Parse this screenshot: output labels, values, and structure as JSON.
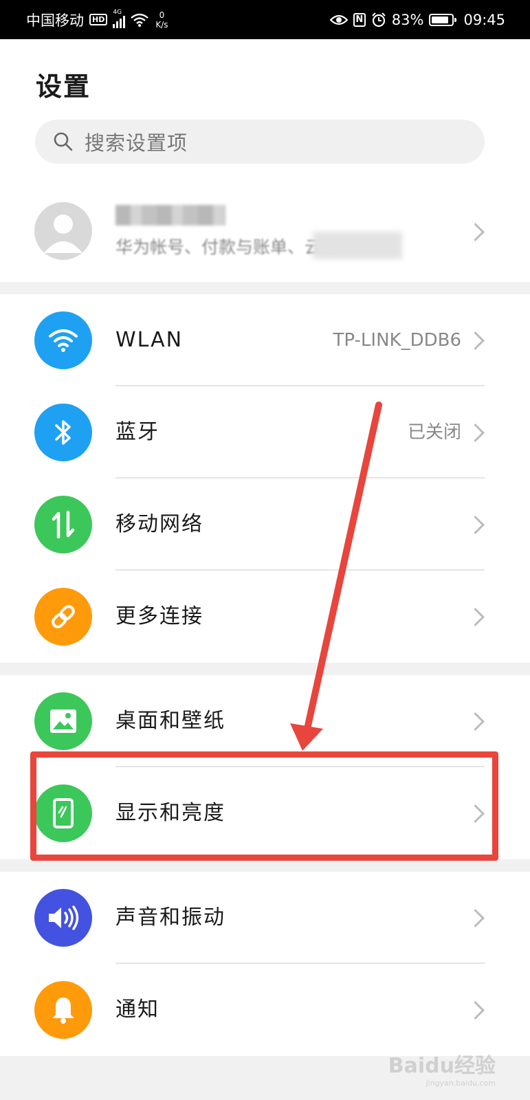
{
  "status_bar": {
    "carrier": "中国移动",
    "hd": "HD",
    "network": "4G",
    "speed_value": "0",
    "speed_unit": "K/s",
    "nfc": "N",
    "battery_percent": "83%",
    "battery_level": 0.83,
    "time": "09:45"
  },
  "page": {
    "title": "设置"
  },
  "search": {
    "placeholder": "搜索设置项"
  },
  "account": {
    "subtitle": "华为帐号、付款与账单、云空间等"
  },
  "groups": [
    {
      "items": [
        {
          "label": "WLAN",
          "value": "TP-LINK_DDB6",
          "icon": "wifi-icon",
          "color": "#1ea1f2"
        },
        {
          "label": "蓝牙",
          "value": "已关闭",
          "icon": "bluetooth-icon",
          "color": "#1ea1f2"
        },
        {
          "label": "移动网络",
          "value": "",
          "icon": "mobile-data-icon",
          "color": "#3cc75a"
        },
        {
          "label": "更多连接",
          "value": "",
          "icon": "link-icon",
          "color": "#ff9a0a"
        }
      ]
    },
    {
      "items": [
        {
          "label": "桌面和壁纸",
          "value": "",
          "icon": "wallpaper-icon",
          "color": "#3cc75a"
        },
        {
          "label": "显示和亮度",
          "value": "",
          "icon": "display-icon",
          "color": "#3cc75a"
        }
      ]
    },
    {
      "items": [
        {
          "label": "声音和振动",
          "value": "",
          "icon": "sound-icon",
          "color": "#4352e0"
        },
        {
          "label": "通知",
          "value": "",
          "icon": "bell-icon",
          "color": "#ff9a0a"
        }
      ]
    }
  ],
  "annotation": {
    "color": "#e8453c"
  },
  "watermark": {
    "text": "Baidu经验",
    "sub": "jingyan.baidu.com"
  }
}
